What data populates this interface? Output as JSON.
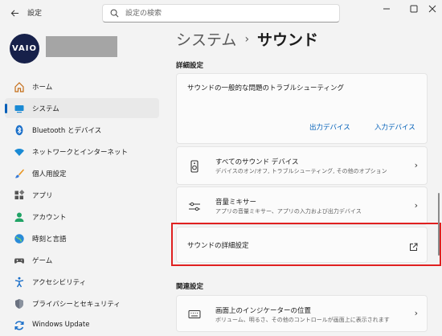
{
  "window": {
    "title": "設定",
    "search_placeholder": "設定の検索"
  },
  "profile": {
    "avatar_text": "VAIO"
  },
  "sidebar": {
    "items": [
      {
        "label": "ホーム",
        "icon": "home-icon"
      },
      {
        "label": "システム",
        "icon": "system-icon",
        "active": true
      },
      {
        "label": "Bluetooth とデバイス",
        "icon": "bluetooth-icon"
      },
      {
        "label": "ネットワークとインターネット",
        "icon": "wifi-icon"
      },
      {
        "label": "個人用設定",
        "icon": "brush-icon"
      },
      {
        "label": "アプリ",
        "icon": "apps-icon"
      },
      {
        "label": "アカウント",
        "icon": "account-icon"
      },
      {
        "label": "時刻と言語",
        "icon": "globe-icon"
      },
      {
        "label": "ゲーム",
        "icon": "gamepad-icon"
      },
      {
        "label": "アクセシビリティ",
        "icon": "accessibility-icon"
      },
      {
        "label": "プライバシーとセキュリティ",
        "icon": "shield-icon"
      },
      {
        "label": "Windows Update",
        "icon": "update-icon"
      }
    ]
  },
  "main": {
    "breadcrumb_parent": "システム",
    "breadcrumb_sep": "›",
    "breadcrumb_current": "サウンド",
    "section_advanced": "詳細設定",
    "troubleshoot": {
      "title": "サウンドの一般的な問題のトラブルシューティング",
      "output_label": "出力デバイス",
      "input_label": "入力デバイス"
    },
    "all_devices": {
      "title": "すべてのサウンド デバイス",
      "desc": "デバイスのオン/オフ, トラブルシューティング, その他のオプション"
    },
    "mixer": {
      "title": "音量ミキサー",
      "desc": "アプリの音量ミキサー、アプリの入力および出力デバイス"
    },
    "advanced_sound": {
      "title": "サウンドの詳細設定"
    },
    "section_related": "関連設定",
    "indicator": {
      "title": "画面上のインジケーターの位置",
      "desc": "ボリューム、明るさ、その他のコントロールが画面上に表示されます"
    }
  },
  "colors": {
    "accent": "#005fb8",
    "highlight": "#e02020"
  }
}
